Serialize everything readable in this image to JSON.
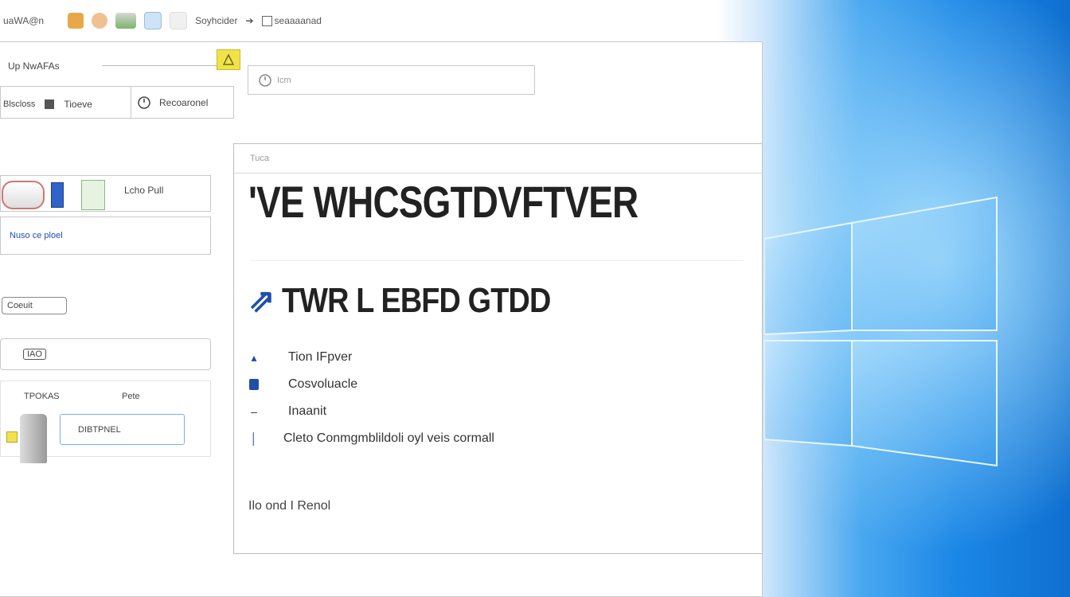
{
  "toolbar": {
    "app_label": "uaWA@n",
    "action_label": "Soyhcider",
    "arrow_glyph": "➔",
    "path_label": "seaaaanad"
  },
  "address_bar": {
    "label": "Up NwAFAs",
    "search_value": "Icm"
  },
  "tabs": [
    {
      "label": "Blscloss"
    },
    {
      "label": "Tioeve"
    },
    {
      "label": "Recoaronel"
    }
  ],
  "left_panel": {
    "app_row_label": "Lcho Pull",
    "sub_label": "Nuso ce ploel",
    "chip_label": "Coeuit",
    "field_value": "IAO",
    "col_left": "TPOKAS",
    "col_right": "Pete",
    "button_label": "DIBTPNEL"
  },
  "content": {
    "header_label": "Tuca",
    "headline": "'VE WHCSGTDVFTVER",
    "subheadline": "TWR L EBFD GTDD",
    "list": [
      {
        "icon": "pin-icon",
        "label": "Tion IFpver"
      },
      {
        "icon": "lock-icon",
        "label": "Cosvoluacle"
      },
      {
        "icon": "dash-icon",
        "label": "Inaanit"
      },
      {
        "icon": "bar-icon",
        "label": "Cleto Conmgmblildoli oyl veis cormall"
      }
    ],
    "footer_label": "Ilo ond I Renol"
  },
  "colors": {
    "accent_blue": "#1f4fa8",
    "wallpaper_blue": "#1b87e6",
    "highlight_yellow": "#f2e24a"
  }
}
